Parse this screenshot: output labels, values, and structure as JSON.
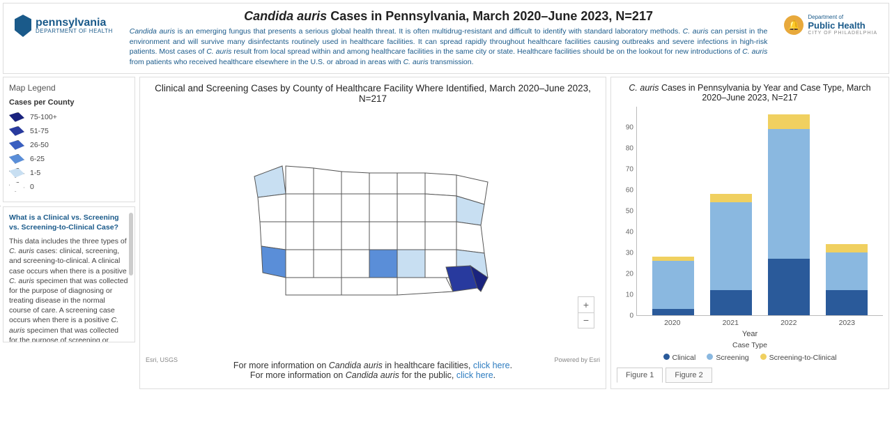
{
  "header": {
    "title_html": "<i>Candida auris</i> Cases in Pennsylvania, March 2020–June 2023, N=217",
    "description_html": "<i>Candida auris</i> is an emerging fungus that presents a serious global health threat. It is often multidrug-resistant and difficult to identify with standard laboratory methods. <i>C. auris</i> can persist in the environment and will survive many disinfectants routinely used in healthcare facilities. It can spread rapidly throughout healthcare facilities causing outbreaks and severe infections in high-risk patients. Most cases of <i>C. auris</i> result from local spread within and among healthcare facilities in the same city or state. Healthcare facilities should be on the lookout for new introductions of <i>C. auris</i> from patients who received healthcare elsewhere in the U.S. or abroad in areas with <i>C. auris</i> transmission.",
    "pa_logo": {
      "line1": "pennsylvania",
      "line2": "DEPARTMENT OF HEALTH"
    },
    "ph_logo": {
      "l1": "Department of",
      "l2": "Public Health",
      "l3": "CITY OF PHILADELPHIA"
    }
  },
  "legend": {
    "title": "Map Legend",
    "subtitle": "Cases per County",
    "items": [
      {
        "label": "75-100+",
        "color": "#1a237e"
      },
      {
        "label": "51-75",
        "color": "#283a9e"
      },
      {
        "label": "26-50",
        "color": "#3a5fc0"
      },
      {
        "label": "6-25",
        "color": "#5a8ed8"
      },
      {
        "label": "1-5",
        "color": "#c8dff2"
      },
      {
        "label": "0",
        "color": "#ffffff"
      }
    ]
  },
  "info": {
    "title": "What is a Clinical vs. Screening vs. Screening-to-Clinical Case?",
    "body_html": "This data includes the three types of <i>C. auris</i> cases: clinical, screening, and screening-to-clinical. A clinical case occurs when there is a positive <i>C. auris</i> specimen that was collected for the purpose of diagnosing or treating disease in the normal course of care. A screening case occurs when there is a positive <i>C. auris</i> specimen that was collected for the purpose of screening or surveillance; screening cases are identified in people without symptoms. Screening-to-clinical cases occur if a"
  },
  "map": {
    "title": "Clinical and Screening Cases by County of Healthcare Facility Where Identified, March 2020–June 2023, N=217",
    "attr_left": "Esri, USGS",
    "attr_right": "Powered by Esri",
    "link1_text": "For more information on ",
    "link1_em": "Candida auris",
    "link1_tail": " in healthcare facilities, ",
    "link1_link": "click here",
    "link2_text": "For more information on ",
    "link2_em": "Candida auris",
    "link2_tail": " for the public, ",
    "link2_link": "click here"
  },
  "chart_data": {
    "type": "bar",
    "title": "C. auris Cases in Pennsylvania by Year and Case Type, March 2020–June 2023, N=217",
    "xlabel": "Year",
    "legend_label": "Case Type",
    "ylim": [
      0,
      100
    ],
    "yticks": [
      0,
      10,
      20,
      30,
      40,
      50,
      60,
      70,
      80,
      90
    ],
    "categories": [
      "2020",
      "2021",
      "2022",
      "2023"
    ],
    "series": [
      {
        "name": "Clinical",
        "color": "#2a5a9a",
        "values": [
          3,
          12,
          27,
          12
        ]
      },
      {
        "name": "Screening",
        "color": "#8ab8e0",
        "values": [
          23,
          42,
          62,
          18
        ]
      },
      {
        "name": "Screening-to-Clinical",
        "color": "#f0d060",
        "values": [
          2,
          4,
          7,
          4
        ]
      }
    ]
  },
  "tabs": {
    "items": [
      "Figure 1",
      "Figure 2"
    ],
    "active": 0
  }
}
